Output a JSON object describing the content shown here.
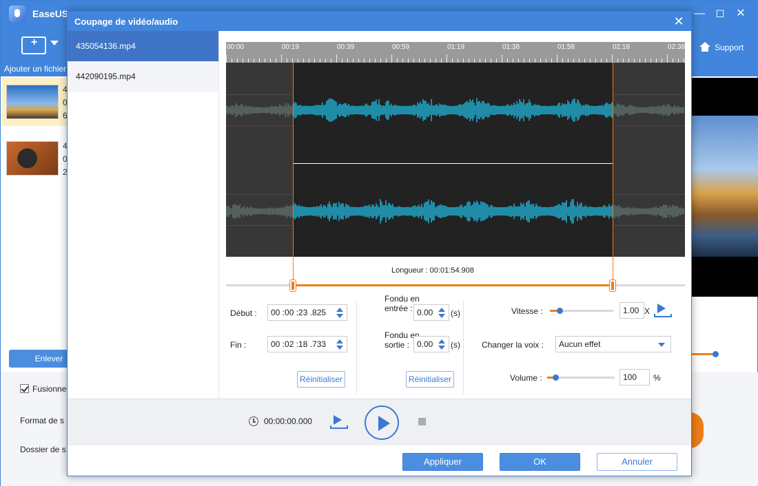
{
  "app": {
    "title": "EaseUS",
    "add_file_label": "Ajouter un fichier",
    "support_label": "Support",
    "files": [
      {
        "line1": "4",
        "line2": "0",
        "line3": "6"
      },
      {
        "line1": "4",
        "line2": "0",
        "line3": "2"
      }
    ],
    "remove_label": "Enlever",
    "merge_label": "Fusionner",
    "format_label": "Format de s",
    "folder_label": "Dossier de s",
    "colors": {
      "accent": "#4285dc",
      "orange": "#f07d18",
      "selection_bg": "#fdf0c4"
    }
  },
  "dialog": {
    "title": "Coupage de vidéo/audio",
    "files": [
      {
        "name": "435054136.mp4",
        "active": true
      },
      {
        "name": "442090195.mp4",
        "active": false
      }
    ],
    "ruler_labels": [
      "00:00",
      "00:19",
      "00:39",
      "00:59",
      "01:19",
      "01:38",
      "01:58",
      "02:18",
      "02:38"
    ],
    "length_label": "Longueur : 00:01:54.908",
    "trim": {
      "start_fraction": 0.145,
      "end_fraction": 0.843
    },
    "start": {
      "label": "Début :",
      "value": "00 :00 :23 .825"
    },
    "end": {
      "label": "Fin :",
      "value": "00 :02 :18 .733"
    },
    "reset_label": "Réinitialiser",
    "fade_in": {
      "label_line1": "Fondu en",
      "label_line2": "entrée :",
      "value": "0.00",
      "unit": "(s)"
    },
    "fade_out": {
      "label_line1": "Fondu en",
      "label_line2": "sortie :",
      "value": "0.00",
      "unit": "(s)"
    },
    "speed": {
      "label": "Vitesse :",
      "value": "1.00",
      "unit": "X",
      "fraction": 0.15
    },
    "voice": {
      "label": "Changer la voix :",
      "value": "Aucun effet"
    },
    "volume": {
      "label": "Volume :",
      "value": "100",
      "unit": "%",
      "fraction": 0.12
    },
    "player": {
      "time": "00:00:00.000"
    },
    "buttons": {
      "apply": "Appliquer",
      "ok": "OK",
      "cancel": "Annuler"
    }
  }
}
